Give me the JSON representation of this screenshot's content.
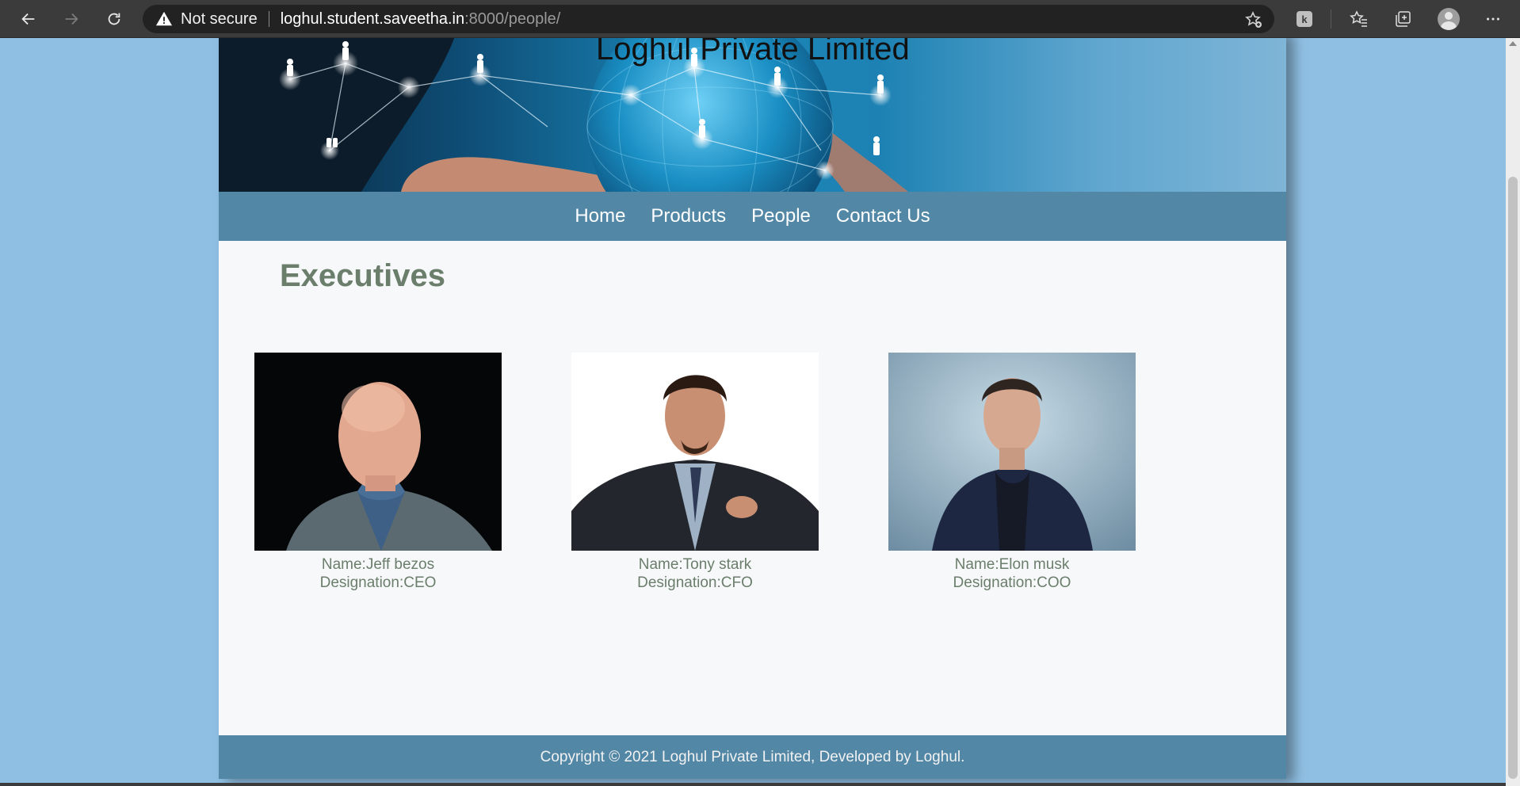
{
  "browser": {
    "security_label": "Not secure",
    "url_host": "loghul.student.saveetha.in",
    "url_rest": ":8000/people/",
    "extension_badge": "k"
  },
  "site": {
    "title": "Loghul Private Limited",
    "nav": [
      "Home",
      "Products",
      "People",
      "Contact Us"
    ],
    "section_title": "Executives",
    "people": [
      {
        "name": "Name:Jeff bezos",
        "designation": "Designation:CEO"
      },
      {
        "name": "Name:Tony stark",
        "designation": "Designation:CFO"
      },
      {
        "name": "Name:Elon musk",
        "designation": "Designation:COO"
      }
    ],
    "footer": "Copyright © 2021 Loghul Private Limited, Developed by Loghul."
  },
  "colors": {
    "page_background": "#8fbfe2",
    "nav_bar": "#5287a6",
    "heading_text": "#6b7d6b",
    "content_background": "#f6f8fa"
  },
  "icons": [
    "back-arrow-icon",
    "forward-arrow-icon",
    "reload-icon",
    "warning-icon",
    "add-favorite-icon",
    "favorites-icon",
    "collections-icon",
    "profile-icon",
    "more-icon"
  ]
}
